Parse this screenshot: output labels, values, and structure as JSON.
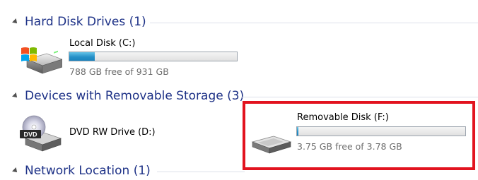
{
  "groups": [
    {
      "title": "Hard Disk Drives (1)"
    },
    {
      "title": "Devices with Removable Storage (3)"
    },
    {
      "title": "Network Location (1)"
    }
  ],
  "drives": {
    "local_c": {
      "name": "Local Disk (C:)",
      "free_text": "788 GB free of 931 GB",
      "used_fraction": 0.154,
      "icon": "windows-hard-disk-icon"
    },
    "dvd_d": {
      "name": "DVD RW Drive (D:)",
      "icon": "dvd-drive-icon",
      "icon_label": "DVD"
    },
    "removable_f": {
      "name": "Removable Disk (F:)",
      "free_text": "3.75 GB free of 3.78 GB",
      "used_fraction": 0.008,
      "icon": "removable-disk-icon"
    }
  },
  "colors": {
    "group_title": "#1e3287",
    "highlight": "#e2131f",
    "bar_fill": "#2690c8"
  }
}
